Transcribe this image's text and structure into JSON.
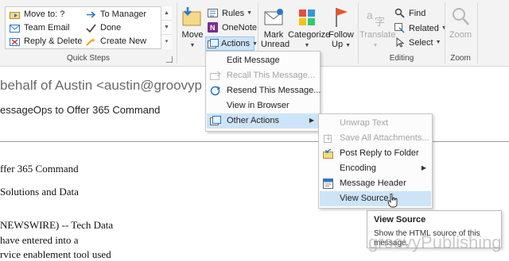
{
  "ribbon": {
    "quick_steps": {
      "group_label": "Quick Steps",
      "items": [
        {
          "label": "Move to: ?"
        },
        {
          "label": "Team Email"
        },
        {
          "label": "Reply & Delete"
        },
        {
          "label": "To Manager"
        },
        {
          "label": "Done"
        },
        {
          "label": "Create New"
        }
      ]
    },
    "move": {
      "move_label": "Move",
      "rules_label": "Rules",
      "onenote_label": "OneNote",
      "actions_label": "Actions"
    },
    "tags": {
      "mark_unread_line1": "Mark",
      "mark_unread_line2": "Unread",
      "categorize_line1": "Categorize",
      "follow_up_line1": "Follow",
      "follow_up_line2": "Up"
    },
    "editing": {
      "group_label": "Editing",
      "translate_label": "Translate",
      "find_label": "Find",
      "related_label": "Related",
      "select_label": "Select"
    },
    "zoom": {
      "group_label": "Zoom",
      "zoom_label": "Zoom"
    }
  },
  "message": {
    "sender_line": "behalf of Austin <austin@groovyp",
    "subject_line": "essageOps to Offer 365 Command",
    "body_lines": [
      "ffer 365 Command",
      "Solutions and Data",
      "NEWSWIRE) -- Tech Data",
      "have entered into a",
      "rvice enablement tool used"
    ]
  },
  "actions_menu": {
    "items": [
      {
        "label": "Edit Message",
        "disabled": false
      },
      {
        "label": "Recall This Message...",
        "disabled": true
      },
      {
        "label": "Resend This Message...",
        "disabled": false
      },
      {
        "label": "View in Browser",
        "disabled": false
      },
      {
        "label": "Other Actions",
        "disabled": false,
        "has_submenu": true,
        "selected": true
      }
    ]
  },
  "other_actions_menu": {
    "items": [
      {
        "label": "Unwrap Text",
        "disabled": true
      },
      {
        "label": "Save All Attachments...",
        "disabled": true
      },
      {
        "label": "Post Reply to Folder",
        "disabled": false
      },
      {
        "label": "Encoding",
        "disabled": false,
        "has_submenu": true
      },
      {
        "label": "Message Header",
        "disabled": false
      },
      {
        "label": "View Source",
        "disabled": false,
        "selected": true
      }
    ]
  },
  "tooltip": {
    "title": "View Source",
    "description": "Show the HTML source of this message."
  },
  "watermark": "groovyPublishing",
  "colors": {
    "ribbon_bg": "#f3f3f3",
    "menu_highlight": "#cde4f7",
    "disabled_text": "#a4a4a4",
    "accent_blue": "#2b78c5"
  }
}
